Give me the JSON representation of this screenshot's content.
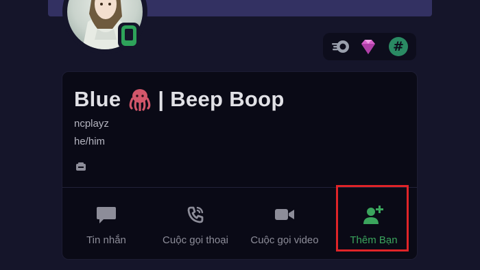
{
  "profile": {
    "display_name_part1": "Blue",
    "display_name_part2": "| Beep Boop",
    "username": "ncplayz",
    "pronouns": "he/him"
  },
  "actions": [
    {
      "label": "Tin nhắn",
      "icon": "chat-bubble-icon"
    },
    {
      "label": "Cuộc gọi thoại",
      "icon": "phone-icon"
    },
    {
      "label": "Cuộc gọi video",
      "icon": "video-camera-icon"
    },
    {
      "label": "Thêm Bạn",
      "icon": "add-friend-icon"
    }
  ],
  "badges": {
    "tag_symbol": "#",
    "icons": [
      "nitro-icon",
      "boost-gem-icon",
      "hypesquad-icon"
    ]
  },
  "colors": {
    "background": "#15152a",
    "banner": "#333162",
    "card": "#0a0a16",
    "accent_green": "#3ba55d",
    "highlight_red": "#e02428",
    "muted_text": "#8d8d99"
  }
}
